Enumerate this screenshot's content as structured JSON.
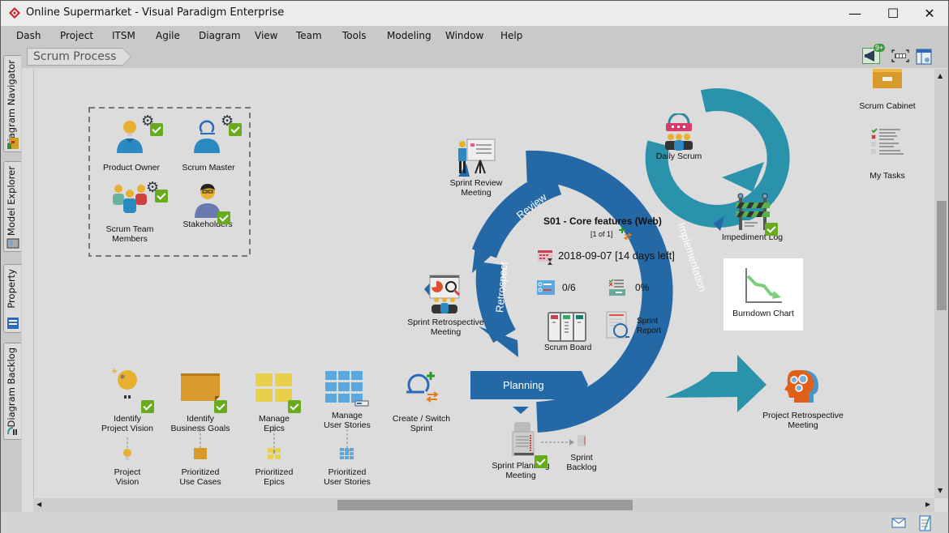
{
  "window": {
    "title": "Online Supermarket - Visual Paradigm Enterprise",
    "minimize_glyph": "—",
    "maximize_glyph": "☐",
    "close_glyph": "✕"
  },
  "menu": [
    "Dash",
    "Project",
    "ITSM",
    "Agile",
    "Diagram",
    "View",
    "Team",
    "Tools",
    "Modeling",
    "Window",
    "Help"
  ],
  "left_tabs": [
    "Diagram Navigator",
    "Model Explorer",
    "Property",
    "Diagram Backlog"
  ],
  "breadcrumb": "Scrum Process",
  "toolbar": {
    "notification_badge": "9+"
  },
  "roles": [
    {
      "label": "Product Owner"
    },
    {
      "label": "Scrum Master"
    },
    {
      "label": "Scrum Team\nMembers"
    },
    {
      "label": "Stakeholders"
    }
  ],
  "sprint": {
    "name": "S01 - Core features (Web)",
    "index": "[1 of 1]",
    "date": "2018-09-07 [14 days left]",
    "stories": "0/6",
    "progress": "0%",
    "scrum_board": "Scrum Board",
    "sprint_report": "Sprint\nReport"
  },
  "phases": {
    "review": "Review",
    "implementation": "Implementation",
    "retrospect": "Retrospect",
    "planning": "Planning"
  },
  "nodes": {
    "sprint_review": "Sprint Review\nMeeting",
    "sprint_retro": "Sprint Retrospective\nMeeting",
    "daily_scrum": "Daily Scrum",
    "impediment_log": "Impediment Log",
    "burndown_chart": "Burndown Chart",
    "project_retro": "Project Retrospective\nMeeting",
    "scrum_cabinet": "Scrum Cabinet",
    "my_tasks": "My Tasks",
    "sprint_planning": "Sprint Planning\nMeeting",
    "sprint_backlog": "Sprint\nBacklog",
    "create_switch_sprint": "Create / Switch\nSprint"
  },
  "backlog_steps": [
    {
      "action": "Identify\nProject Vision",
      "artifact": "Project\nVision"
    },
    {
      "action": "Identify\nBusiness Goals",
      "artifact": "Prioritized\nUse Cases"
    },
    {
      "action": "Manage\nEpics",
      "artifact": "Prioritized\nEpics"
    },
    {
      "action": "Manage\nUser Stories",
      "artifact": "Prioritized\nUser Stories"
    }
  ],
  "colors": {
    "cycle_blue": "#2469a5",
    "teal": "#2a93ab",
    "check_green": "#6aaa1e"
  }
}
